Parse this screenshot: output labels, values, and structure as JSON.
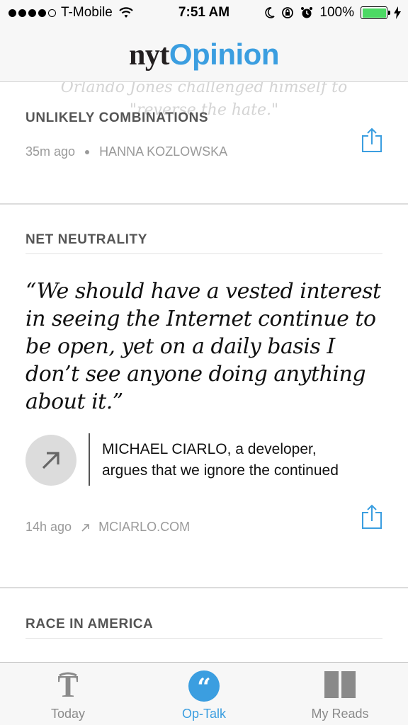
{
  "status_bar": {
    "carrier": "T-Mobile",
    "time": "7:51 AM",
    "battery": "100%"
  },
  "header": {
    "logo_nyt": "nyt",
    "logo_opinion": "Opinion"
  },
  "feed": {
    "faded_quote": "Orlando Jones challenged himself to \"reverse the hate.\"",
    "cards": [
      {
        "section": "UNLIKELY COMBINATIONS",
        "time": "35m ago",
        "byline": "HANNA KOZLOWSKA"
      },
      {
        "section": "NET NEUTRALITY",
        "quote_lines": [
          "“We should have a vested interest",
          "in seeing the Internet continue to",
          "be open, yet on a daily basis I",
          "don’t see anyone doing anything",
          "about it.”"
        ],
        "source_lines": [
          "MICHAEL CIARLO, a developer,",
          "argues that we ignore the continued"
        ],
        "time": "14h ago",
        "link": "MCIARLO.COM"
      },
      {
        "section": "RACE IN AMERICA"
      }
    ]
  },
  "tabs": [
    {
      "label": "Today",
      "icon": "nyt-t-icon"
    },
    {
      "label": "Op-Talk",
      "icon": "quote-icon",
      "active": true
    },
    {
      "label": "My Reads",
      "icon": "book-icon"
    }
  ],
  "colors": {
    "accent": "#3b9ee0",
    "battery": "#4cd964"
  }
}
